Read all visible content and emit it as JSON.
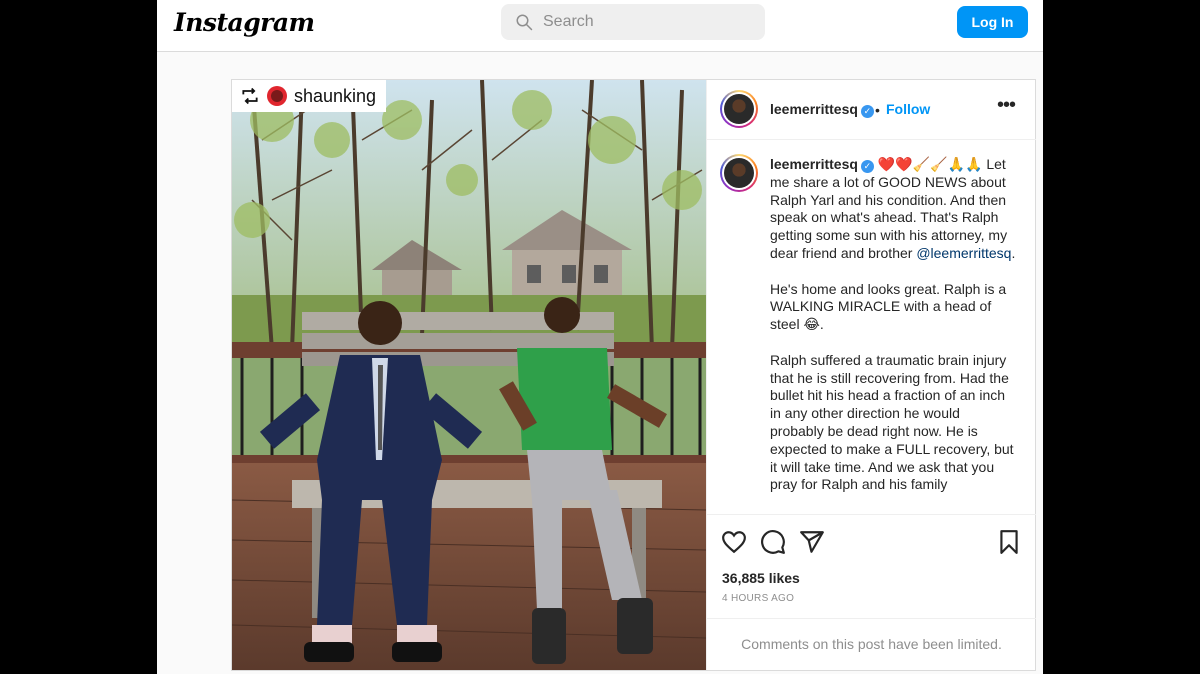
{
  "topbar": {
    "logo": "Instagram",
    "search_placeholder": "Search",
    "login_label": "Log In"
  },
  "photo": {
    "repost_username": "shaunking",
    "alt": "Two people sitting on a wooden bench on a deck with trees behind"
  },
  "post": {
    "author": "leemerrittesq",
    "follow_label": "Follow",
    "separator": "•",
    "caption_author": "leemerrittesq",
    "caption_emojis": "❤️❤️🧹🧹🙏🙏",
    "caption_lines": [
      "Let me share a lot of GOOD NEWS about Ralph Yarl and his condition. And then speak on what's ahead. That's Ralph getting some sun with his attorney, my dear friend and brother ",
      "He's home and looks great. Ralph is a WALKING MIRACLE with a head of steel 😂.",
      "Ralph suffered a traumatic brain injury that he is still recovering from. Had the bullet hit his head a fraction of an inch in any other direction he would probably be dead right now. He is expected to make a FULL recovery, but it will take time. And we ask that you pray for Ralph and his family"
    ],
    "caption_mention": "@leemerrittesq",
    "likes": "36,885 likes",
    "time_ago": "4 HOURS AGO",
    "comments_limited": "Comments on this post have been limited."
  },
  "colors": {
    "accent": "#0095f6",
    "verified": "#3897f0",
    "border": "#dbdbdb",
    "muted": "#8e8e8e"
  },
  "icons": [
    "search-icon",
    "repost-icon",
    "verified-icon",
    "more-icon",
    "heart-icon",
    "comment-icon",
    "share-icon",
    "bookmark-icon"
  ]
}
